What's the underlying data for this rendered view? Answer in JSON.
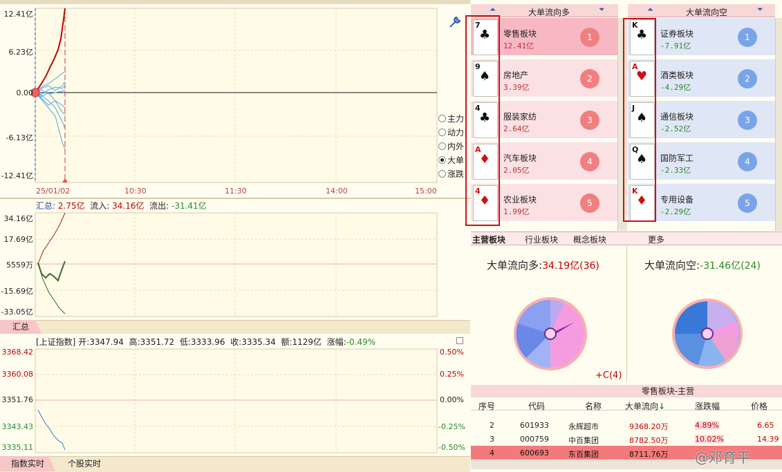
{
  "main_chart": {
    "y_labels": [
      "12.41亿",
      "6.23亿",
      "0.00",
      "-6.13亿",
      "-12.41亿"
    ],
    "x_labels": [
      "25/01/02",
      "10:30",
      "11:30",
      "14:00",
      "15:00"
    ],
    "radio_options": [
      {
        "label": "主力",
        "checked": false
      },
      {
        "label": "动力",
        "checked": false
      },
      {
        "label": "内外",
        "checked": false
      },
      {
        "label": "大单",
        "checked": true
      },
      {
        "label": "涨跌",
        "checked": false
      }
    ]
  },
  "summary_chart": {
    "title_total_label": "汇总:",
    "title_total_value": "2.75亿",
    "inflow_label": "流入:",
    "inflow_value": "34.16亿",
    "outflow_label": "流出:",
    "outflow_value": "-31.41亿",
    "y_labels": [
      "34.16亿",
      "17.69亿",
      "5559万",
      "-15.69亿",
      "-33.05亿"
    ],
    "tab_label": "汇总"
  },
  "index_chart": {
    "name": "[上证指数]",
    "open_label": "开:",
    "open": "3347.94",
    "high_label": "高:",
    "high": "3351.72",
    "low_label": "低:",
    "low": "3333.96",
    "close_label": "收:",
    "close": "3335.34",
    "amount_label": "额:",
    "amount": "1129亿",
    "change_label": "涨幅:",
    "change": "-0.49%",
    "y_labels": [
      "3368.42",
      "3360.08",
      "3351.76",
      "3343.43",
      "3335.11"
    ],
    "pct_labels": [
      "0.50%",
      "0.25%",
      "0.00%",
      "-0.25%",
      "-0.50%"
    ]
  },
  "bottom_tabs": [
    "指数实时",
    "个股实时"
  ],
  "long_panel": {
    "header": "大单流向多",
    "items": [
      {
        "rank": "1",
        "name": "零售板块",
        "value": "12.41亿",
        "card": "7",
        "suit": "♣",
        "red": false
      },
      {
        "rank": "2",
        "name": "房地产",
        "value": "3.39亿",
        "card": "9",
        "suit": "♠",
        "red": false
      },
      {
        "rank": "3",
        "name": "服装家纺",
        "value": "2.64亿",
        "card": "4",
        "suit": "♣",
        "red": false
      },
      {
        "rank": "4",
        "name": "汽车板块",
        "value": "2.05亿",
        "card": "A",
        "suit": "♦",
        "red": true
      },
      {
        "rank": "5",
        "name": "农业板块",
        "value": "1.99亿",
        "card": "4",
        "suit": "♦",
        "red": true
      }
    ]
  },
  "short_panel": {
    "header": "大单流向空",
    "items": [
      {
        "rank": "1",
        "name": "证券板块",
        "value": "-7.91亿",
        "card": "K",
        "suit": "♣",
        "red": false
      },
      {
        "rank": "2",
        "name": "酒类板块",
        "value": "-4.29亿",
        "card": "A",
        "suit": "♥",
        "red": true
      },
      {
        "rank": "3",
        "name": "通信板块",
        "value": "-2.52亿",
        "card": "J",
        "suit": "♠",
        "red": false
      },
      {
        "rank": "4",
        "name": "国防军工",
        "value": "-2.33亿",
        "card": "Q",
        "suit": "♠",
        "red": false
      },
      {
        "rank": "5",
        "name": "专用设备",
        "value": "-2.29亿",
        "card": "K",
        "suit": "♦",
        "red": true
      }
    ]
  },
  "sector_tabs": [
    "主营板块",
    "行业板块",
    "概念板块",
    "更多"
  ],
  "pie_long": {
    "label": "大单流向多:",
    "value": "34.19亿(36)",
    "footer": "+C(4)"
  },
  "pie_short": {
    "label": "大单流向空:",
    "value": "-31.46亿(24)"
  },
  "table": {
    "title": "零售板块-主营",
    "headers": [
      "序号",
      "代码",
      "名称",
      "大单流向",
      "涨跌幅",
      "价格"
    ],
    "rows": [
      {
        "no": "2",
        "code": "601933",
        "name": "永辉超市",
        "flow": "9368.20万",
        "chg": "4.89%",
        "price": "6.65",
        "selected": false
      },
      {
        "no": "3",
        "code": "000759",
        "name": "中百集团",
        "flow": "8782.50万",
        "chg": "10.02%",
        "price": "14.39",
        "selected": false
      },
      {
        "no": "4",
        "code": "600693",
        "name": "东百集团",
        "flow": "8711.76万",
        "chg": "",
        "price": "",
        "selected": true
      }
    ]
  },
  "watermark": "@邓育平",
  "colors": {
    "up": "#c00000",
    "down": "#2a8a2a",
    "accent": "#e03030",
    "highlight": "#d01010"
  }
}
